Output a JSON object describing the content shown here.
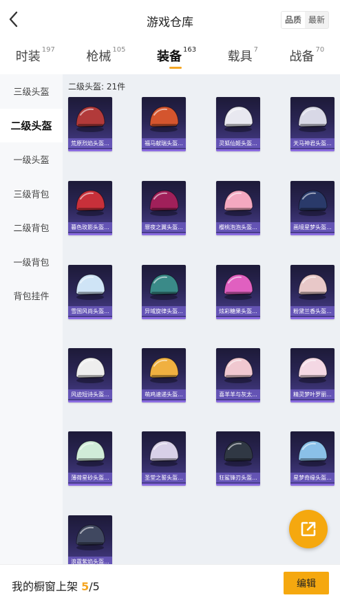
{
  "header": {
    "title": "游戏仓库",
    "sort_options": [
      "品质",
      "最新"
    ]
  },
  "tabs": [
    {
      "label": "时装",
      "count": "197"
    },
    {
      "label": "枪械",
      "count": "105"
    },
    {
      "label": "装备",
      "count": "163"
    },
    {
      "label": "载具",
      "count": "7"
    },
    {
      "label": "战备",
      "count": "70"
    }
  ],
  "sidebar": {
    "items": [
      "三级头盔",
      "二级头盔",
      "一级头盔",
      "三级背包",
      "二级背包",
      "一级背包",
      "背包挂件"
    ]
  },
  "grid": {
    "heading": "二级头盔: 21件",
    "items": [
      {
        "name": "荒原烈焰头盔...",
        "color": "#b23a3a"
      },
      {
        "name": "福马献瑞头盔...",
        "color": "#d4552e"
      },
      {
        "name": "灵狐仙姬头盔...",
        "color": "#e8e8f0"
      },
      {
        "name": "天马神君头盔...",
        "color": "#d8d8e6"
      },
      {
        "name": "暮色玫影头盔...",
        "color": "#c8303a"
      },
      {
        "name": "罪夜之翼头盔...",
        "color": "#a0205a"
      },
      {
        "name": "樱桃泡泡头盔...",
        "color": "#f4a8c0"
      },
      {
        "name": "画境星梦头盔...",
        "color": "#2a3a6a"
      },
      {
        "name": "雪国风尚头盔...",
        "color": "#cfe4f6"
      },
      {
        "name": "异域旋律头盔...",
        "color": "#3a8a88"
      },
      {
        "name": "炫彩糖果头盔...",
        "color": "#e060c0"
      },
      {
        "name": "粉黛兰香头盔...",
        "color": "#e8c8c8"
      },
      {
        "name": "风迹短诗头盔...",
        "color": "#eeeeee"
      },
      {
        "name": "萌鸡速递头盔...",
        "color": "#f0b040"
      },
      {
        "name": "喜羊羊与灰太...",
        "color": "#f0c8d0"
      },
      {
        "name": "精灵梦叶罗丽...",
        "color": "#f4d8e4"
      },
      {
        "name": "薄荷星砂头盔...",
        "color": "#d0ecd8"
      },
      {
        "name": "圣堂之誓头盔...",
        "color": "#d8d0e8"
      },
      {
        "name": "狂鲨锋刃头盔...",
        "color": "#303844"
      },
      {
        "name": "星梦奇缘头盔...",
        "color": "#8ac0e8"
      },
      {
        "name": "浪霆紫焰头盔...",
        "color": "#404860"
      }
    ]
  },
  "bottom": {
    "showcase_label": "我的橱窗上架",
    "current": "5",
    "total": "/5",
    "edit_label": "编辑"
  },
  "colors": {
    "accent": "#f5a80f",
    "card_top": "#1d1a38",
    "card_bottom": "#4a3f8f"
  },
  "icons": {
    "back": "chevron-left-icon",
    "fab": "external-link-icon"
  }
}
